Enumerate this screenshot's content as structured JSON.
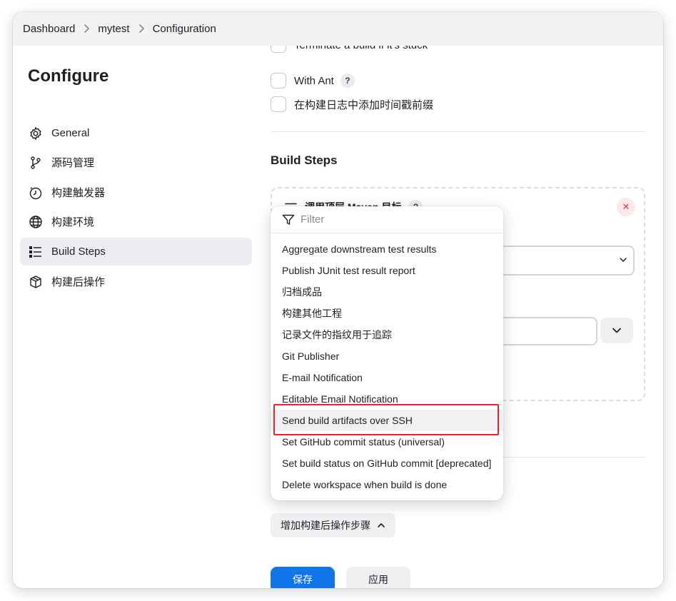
{
  "breadcrumb": {
    "items": [
      "Dashboard",
      "mytest",
      "Configuration"
    ],
    "separator": ">"
  },
  "sidebar": {
    "title": "Configure",
    "items": [
      {
        "label": "General",
        "icon": "gear-icon"
      },
      {
        "label": "源码管理",
        "icon": "branch-icon"
      },
      {
        "label": "构建触发器",
        "icon": "clock-icon"
      },
      {
        "label": "构建环境",
        "icon": "globe-icon"
      },
      {
        "label": "Build Steps",
        "icon": "list-icon",
        "active": true
      },
      {
        "label": "构建后操作",
        "icon": "package-icon"
      }
    ]
  },
  "main": {
    "partial_option": "Terminate a build if it's stuck",
    "options": [
      {
        "label": "With Ant",
        "help": "?"
      },
      {
        "label": "在构建日志中添加时间戳前缀"
      }
    ],
    "build_steps_title": "Build Steps",
    "step": {
      "title": "调用顶层 Maven 目标",
      "help": "?",
      "close": "✕"
    },
    "add_post_build_label": "增加构建后操作步骤",
    "save_label": "保存",
    "apply_label": "应用"
  },
  "dropdown": {
    "filter_placeholder": "Filter",
    "items": [
      "Aggregate downstream test results",
      "Publish JUnit test result report",
      "归档成品",
      "构建其他工程",
      "记录文件的指纹用于追踪",
      "Git Publisher",
      "E-mail Notification",
      "Editable Email Notification",
      "Send build artifacts over SSH",
      "Set GitHub commit status (universal)",
      "Set build status on GitHub commit [deprecated]",
      "Delete workspace when build is done"
    ],
    "highlighted_item": "Send build artifacts over SSH"
  },
  "colors": {
    "accent": "#1075ea",
    "highlight_outline": "#e0262d",
    "close_red": "#e0313f"
  }
}
